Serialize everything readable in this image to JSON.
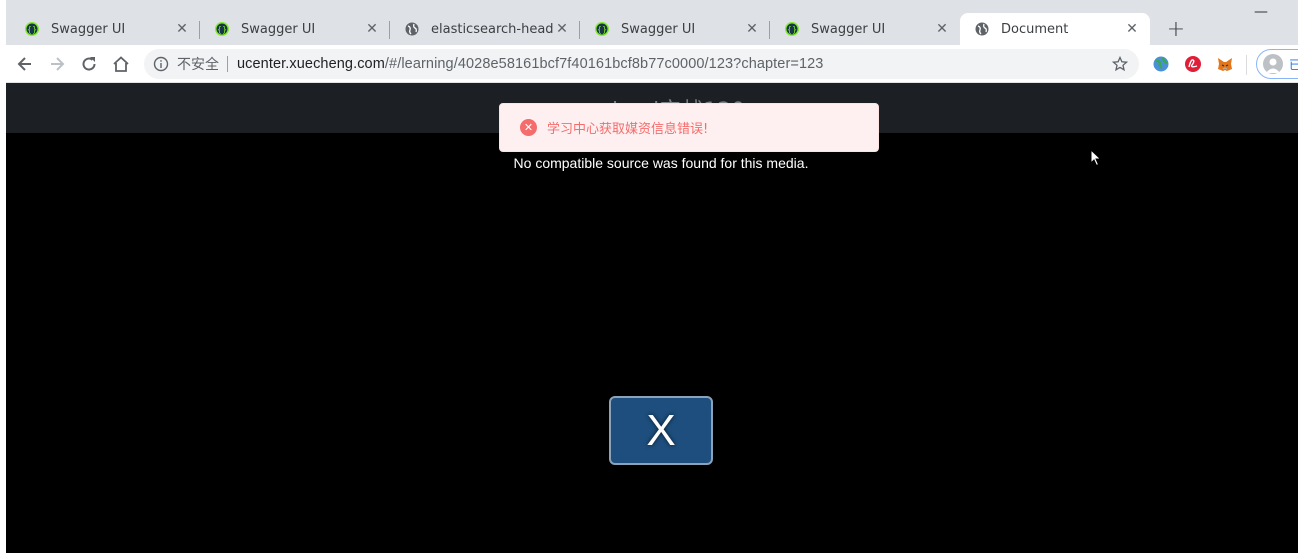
{
  "tabs": [
    {
      "title": "Swagger UI",
      "icon": "swagger-icon"
    },
    {
      "title": "Swagger UI",
      "icon": "swagger-icon"
    },
    {
      "title": "elasticsearch-head",
      "icon": "globe-icon"
    },
    {
      "title": "Swagger UI",
      "icon": "swagger-icon"
    },
    {
      "title": "Swagger UI",
      "icon": "swagger-icon"
    },
    {
      "title": "Document",
      "icon": "globe-icon",
      "active": true
    }
  ],
  "toolbar": {
    "insecure_label": "不安全",
    "url_host": "ucenter.xuecheng.com",
    "url_path": "/#/learning/4028e58161bcf7f40161bcf8b77c0000/123?chapter=123",
    "profile_label": "已"
  },
  "page": {
    "header_title": "i.....l实战120",
    "player_error": "No compatible source was found for this media.",
    "close_button_label": "X"
  },
  "toast": {
    "message": "学习中心获取媒资信息错误!",
    "type": "error",
    "color": "#f56c6c"
  },
  "colors": {
    "tabstrip": "#dee1e6",
    "page_bg": "#000000",
    "x_button": "#1d4e7d"
  }
}
